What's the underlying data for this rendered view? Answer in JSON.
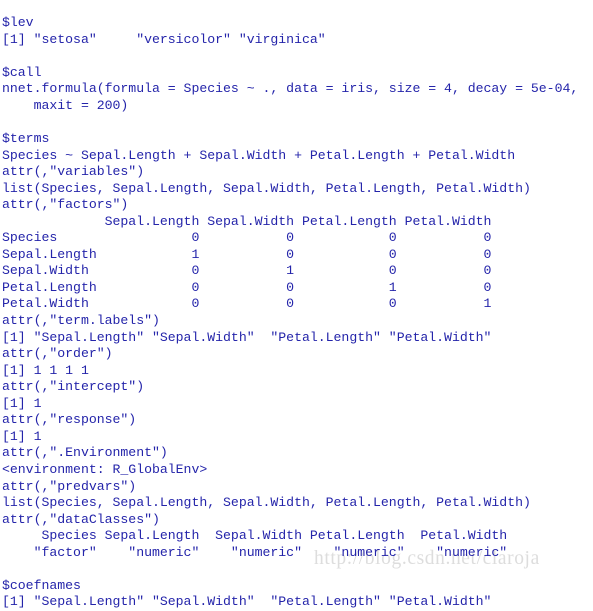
{
  "theme": {
    "background": "#ffffff",
    "text_color": "#2424aa",
    "watermark_color": "#dddddd"
  },
  "watermark": {
    "text": "http://blog.csdn.net/claroja"
  },
  "console": {
    "lines": [
      "$lev",
      "[1] \"setosa\"     \"versicolor\" \"virginica\" ",
      "",
      "$call",
      "nnet.formula(formula = Species ~ ., data = iris, size = 4, decay = 5e-04, ",
      "    maxit = 200)",
      "",
      "$terms",
      "Species ~ Sepal.Length + Sepal.Width + Petal.Length + Petal.Width",
      "attr(,\"variables\")",
      "list(Species, Sepal.Length, Sepal.Width, Petal.Length, Petal.Width)",
      "attr(,\"factors\")",
      "             Sepal.Length Sepal.Width Petal.Length Petal.Width",
      "Species                 0           0            0           0",
      "Sepal.Length            1           0            0           0",
      "Sepal.Width             0           1            0           0",
      "Petal.Length            0           0            1           0",
      "Petal.Width             0           0            0           1",
      "attr(,\"term.labels\")",
      "[1] \"Sepal.Length\" \"Sepal.Width\"  \"Petal.Length\" \"Petal.Width\" ",
      "attr(,\"order\")",
      "[1] 1 1 1 1",
      "attr(,\"intercept\")",
      "[1] 1",
      "attr(,\"response\")",
      "[1] 1",
      "attr(,\".Environment\")",
      "<environment: R_GlobalEnv>",
      "attr(,\"predvars\")",
      "list(Species, Sepal.Length, Sepal.Width, Petal.Length, Petal.Width)",
      "attr(,\"dataClasses\")",
      "     Species Sepal.Length  Sepal.Width Petal.Length  Petal.Width ",
      "    \"factor\"    \"numeric\"    \"numeric\"    \"numeric\"    \"numeric\" ",
      "",
      "$coefnames",
      "[1] \"Sepal.Length\" \"Sepal.Width\"  \"Petal.Length\" \"Petal.Width\" "
    ],
    "sections": {
      "lev": {
        "name": "$lev",
        "index_tag": "[1]",
        "values": [
          "\"setosa\"",
          "\"versicolor\"",
          "\"virginica\""
        ]
      },
      "call": {
        "name": "$call",
        "function": "nnet.formula",
        "args": {
          "formula": "Species ~ .",
          "data": "iris",
          "size": "4",
          "decay": "5e-04",
          "maxit": "200"
        }
      },
      "terms": {
        "name": "$terms",
        "formula": "Species ~ Sepal.Length + Sepal.Width + Petal.Length + Petal.Width",
        "variables_attr": "attr(,\"variables\")",
        "variables": "list(Species, Sepal.Length, Sepal.Width, Petal.Length, Petal.Width)",
        "factors_attr": "attr(,\"factors\")",
        "factors_table": {
          "columns": [
            "Sepal.Length",
            "Sepal.Width",
            "Petal.Length",
            "Petal.Width"
          ],
          "rows": [
            {
              "label": "Species",
              "values": [
                0,
                0,
                0,
                0
              ]
            },
            {
              "label": "Sepal.Length",
              "values": [
                1,
                0,
                0,
                0
              ]
            },
            {
              "label": "Sepal.Width",
              "values": [
                0,
                1,
                0,
                0
              ]
            },
            {
              "label": "Petal.Length",
              "values": [
                0,
                0,
                1,
                0
              ]
            },
            {
              "label": "Petal.Width",
              "values": [
                0,
                0,
                0,
                1
              ]
            }
          ]
        },
        "term_labels_attr": "attr(,\"term.labels\")",
        "term_labels": [
          "\"Sepal.Length\"",
          "\"Sepal.Width\"",
          "\"Petal.Length\"",
          "\"Petal.Width\""
        ],
        "order_attr": "attr(,\"order\")",
        "order": [
          1,
          1,
          1,
          1
        ],
        "intercept_attr": "attr(,\"intercept\")",
        "intercept": [
          1
        ],
        "response_attr": "attr(,\"response\")",
        "response": [
          1
        ],
        "environment_attr": "attr(,\".Environment\")",
        "environment": "<environment: R_GlobalEnv>",
        "predvars_attr": "attr(,\"predvars\")",
        "predvars": "list(Species, Sepal.Length, Sepal.Width, Petal.Length, Petal.Width)",
        "data_classes_attr": "attr(,\"dataClasses\")",
        "data_classes": {
          "names": [
            "Species",
            "Sepal.Length",
            "Sepal.Width",
            "Petal.Length",
            "Petal.Width"
          ],
          "values": [
            "\"factor\"",
            "\"numeric\"",
            "\"numeric\"",
            "\"numeric\"",
            "\"numeric\""
          ]
        }
      },
      "coefnames": {
        "name": "$coefnames",
        "index_tag": "[1]",
        "values": [
          "\"Sepal.Length\"",
          "\"Sepal.Width\"",
          "\"Petal.Length\"",
          "\"Petal.Width\""
        ]
      }
    }
  }
}
